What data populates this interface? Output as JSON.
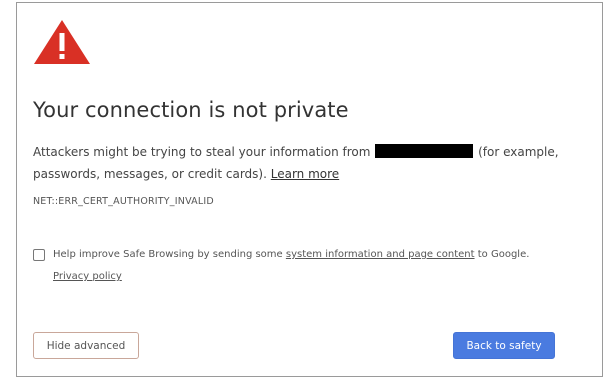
{
  "icon": {
    "name": "warning-icon",
    "color": "#d93025"
  },
  "heading": "Your connection is not private",
  "message": {
    "part1": "Attackers might be trying to steal your information from",
    "part2": "(for example, passwords, messages, or credit cards).",
    "learn_more": "Learn more"
  },
  "error_code": "NET::ERR_CERT_AUTHORITY_INVALID",
  "safe_browsing": {
    "checked": false,
    "text_before": "Help improve Safe Browsing by sending some",
    "link": "system information and page content",
    "text_after": "to Google.",
    "privacy_policy": "Privacy policy"
  },
  "buttons": {
    "hide_advanced": "Hide advanced",
    "back_to_safety": "Back to safety"
  },
  "colors": {
    "primary_button": "#4a7be0",
    "secondary_button_border": "#c9a79a"
  }
}
